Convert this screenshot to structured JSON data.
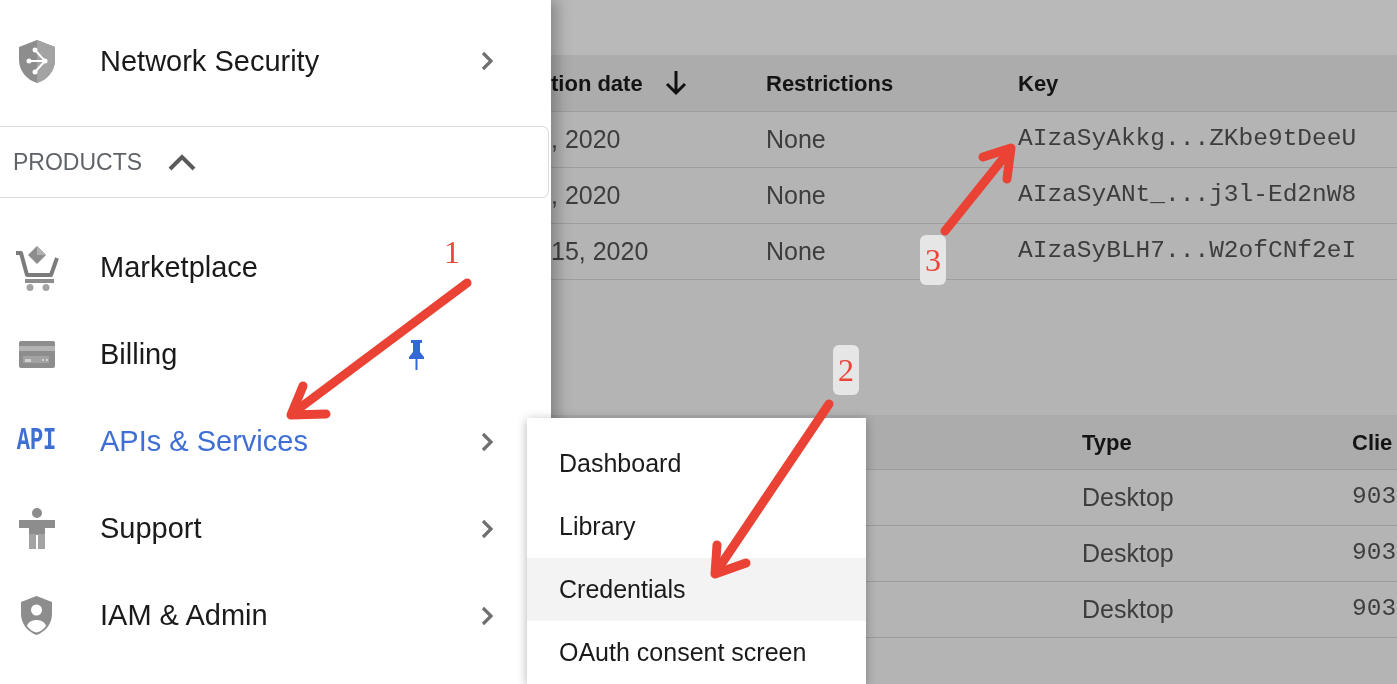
{
  "nav_drawer": {
    "items": [
      {
        "label": "Network Security",
        "selected": false,
        "pinned": false,
        "has_submenu": true
      }
    ],
    "section": {
      "label": "PRODUCTS",
      "expanded": true,
      "items": [
        {
          "label": "Marketplace",
          "selected": false,
          "pinned": false,
          "has_submenu": false
        },
        {
          "label": "Billing",
          "selected": false,
          "pinned": true,
          "has_submenu": false
        },
        {
          "label": "APIs & Services",
          "icon_text": "API",
          "selected": true,
          "pinned": false,
          "has_submenu": true
        },
        {
          "label": "Support",
          "selected": false,
          "pinned": false,
          "has_submenu": true
        },
        {
          "label": "IAM & Admin",
          "selected": false,
          "pinned": false,
          "has_submenu": true
        }
      ]
    }
  },
  "submenu": {
    "items": [
      {
        "label": "Dashboard",
        "highlighted": false
      },
      {
        "label": "Library",
        "highlighted": false
      },
      {
        "label": "Credentials",
        "highlighted": true
      },
      {
        "label": "OAuth consent screen",
        "highlighted": false
      }
    ]
  },
  "tables": [
    {
      "columns": [
        {
          "label": "tion date",
          "kind": "text",
          "sorted": true
        },
        {
          "label": "Restrictions",
          "kind": "text",
          "sorted": false
        },
        {
          "label": "Key",
          "kind": "code",
          "sorted": false
        }
      ],
      "rows": [
        [
          ", 2020",
          "None",
          "AIzaSyAkkg...ZKbe9tDeeU"
        ],
        [
          ", 2020",
          "None",
          "AIzaSyANt_...j3l-Ed2nW8"
        ],
        [
          "15, 2020",
          "None",
          "AIzaSyBLH7...W2ofCNf2eI"
        ]
      ]
    },
    {
      "columns": [
        {
          "label": "Type",
          "kind": "text",
          "sorted": false
        },
        {
          "label": "Clie",
          "kind": "code",
          "sorted": false
        }
      ],
      "rows": [
        [
          "Desktop",
          "903"
        ],
        [
          "Desktop",
          "903"
        ],
        [
          "Desktop",
          "903"
        ]
      ]
    }
  ],
  "annotations": [
    {
      "label": "1",
      "boxed": false
    },
    {
      "label": "2",
      "boxed": true
    },
    {
      "label": "3",
      "boxed": true
    }
  ]
}
